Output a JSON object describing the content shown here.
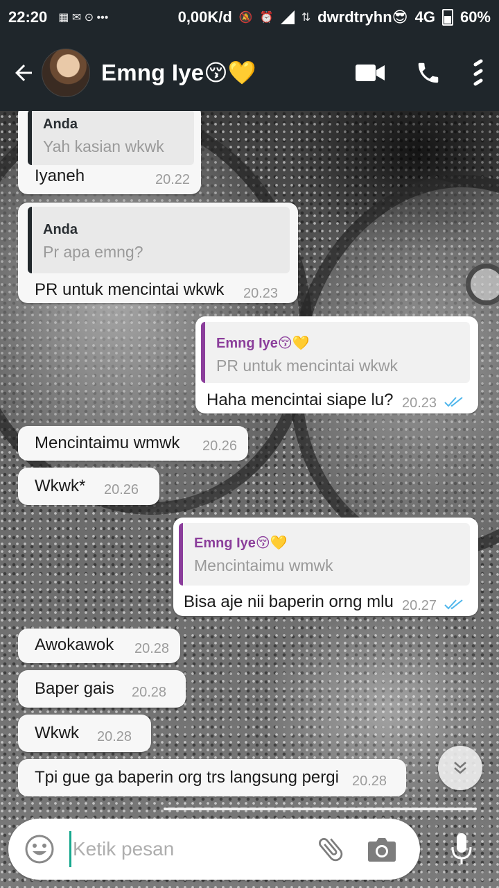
{
  "status_bar": {
    "time": "22:20",
    "net_speed": "0,00K/d",
    "carrier": "dwrdtryhn😎",
    "network": "4G",
    "battery": "60%"
  },
  "header": {
    "contact_name": "Emng Iye😚💛",
    "icons": [
      "back-arrow",
      "avatar",
      "video-call",
      "voice-call",
      "overflow-menu"
    ]
  },
  "messages": [
    {
      "direction": "in",
      "quote_author": "Anda",
      "quote_text": "Yah kasian wkwk",
      "text": "Iyaneh",
      "time": "20.22"
    },
    {
      "direction": "in",
      "quote_author": "Anda",
      "quote_text": "Pr apa emng?",
      "text": "PR untuk mencintai wkwk",
      "time": "20.23"
    },
    {
      "direction": "out",
      "quote_author": "Emng Iye😚💛",
      "quote_text": "PR untuk mencintai wkwk",
      "text": "Haha mencintai siape lu?",
      "time": "20.23",
      "status": "read"
    },
    {
      "direction": "in",
      "text": "Mencintaimu wmwk",
      "time": "20.26"
    },
    {
      "direction": "in",
      "text": "Wkwk*",
      "time": "20.26"
    },
    {
      "direction": "out",
      "quote_author": "Emng Iye😚💛",
      "quote_text": "Mencintaimu wmwk",
      "text": "Bisa aje nii baperin orng mlu",
      "time": "20.27",
      "status": "read"
    },
    {
      "direction": "in",
      "text": "Awokawok",
      "time": "20.28"
    },
    {
      "direction": "in",
      "text": "Baper gais",
      "time": "20.28"
    },
    {
      "direction": "in",
      "text": "Wkwk",
      "time": "20.28"
    },
    {
      "direction": "in",
      "text": "Tpi gue ga baperin org trs langsung pergi",
      "time": "20.28"
    }
  ],
  "composer": {
    "placeholder": "Ketik pesan",
    "icons": [
      "emoji-icon",
      "attach-icon",
      "camera-icon",
      "mic-icon"
    ]
  },
  "colors": {
    "toolbar": "#1f262b",
    "quote_out_accent": "#8b3e9b",
    "quote_in_accent": "#22282c",
    "read_ticks": "#4fb6ec",
    "caret": "#17a88e"
  }
}
